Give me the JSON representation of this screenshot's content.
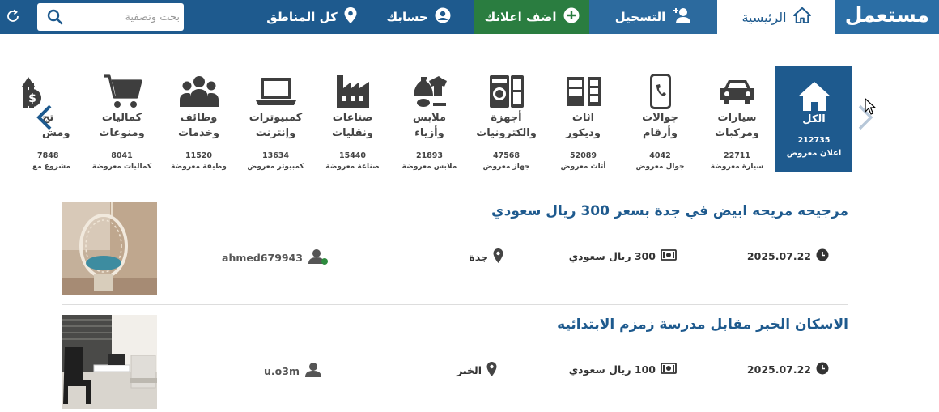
{
  "nav": {
    "brand": "مستعمل",
    "home": "الرئيسية",
    "register": "التسجيل",
    "add_ad": "اضف اعلانك",
    "account": "حسابك",
    "regions": "كل المناطق",
    "search_placeholder": "بحث وتصفية"
  },
  "categories": [
    {
      "name": "الكل",
      "count": "212735",
      "label": "اعلان معروض",
      "icon": "home-icon"
    },
    {
      "name": "سيارات\nومركبات",
      "count": "22711",
      "label": "سيارة معروضة",
      "icon": "car-icon"
    },
    {
      "name": "جوالات\nوأرقام",
      "count": "4042",
      "label": "جوال معروض",
      "icon": "phone-icon"
    },
    {
      "name": "اثاث\nوديكور",
      "count": "52089",
      "label": "أثاث معروض",
      "icon": "furniture-icon"
    },
    {
      "name": "أجهزة\nوالكترونيات",
      "count": "47568",
      "label": "جهاز معروض",
      "icon": "appliance-icon"
    },
    {
      "name": "ملابس\nوأزياء",
      "count": "21893",
      "label": "ملابس معروضة",
      "icon": "clothes-icon"
    },
    {
      "name": "صناعات\nونقليات",
      "count": "15440",
      "label": "صناعة معروضة",
      "icon": "factory-icon"
    },
    {
      "name": "كمبيوترات\nوإنترنت",
      "count": "13634",
      "label": "كمبيوتر معروض",
      "icon": "laptop-icon"
    },
    {
      "name": "وظائف\nوخدمات",
      "count": "11520",
      "label": "وظيفة معروضة",
      "icon": "people-icon"
    },
    {
      "name": "كماليات\nومنوعات",
      "count": "8041",
      "label": "كماليات معروضة",
      "icon": "cart-icon"
    },
    {
      "name": "تج\nومش",
      "count": "7848",
      "label": "مشروع مع",
      "icon": "money-icon"
    }
  ],
  "listings": [
    {
      "title": "مرجيحه مريحه ابيض في جدة بسعر 300 ريال سعودي",
      "date": "2025.07.22",
      "price": "300 ريال سعودي",
      "city": "جدة",
      "user": "ahmed679943",
      "online": true
    },
    {
      "title": "الاسكان الخبر مقابل مدرسة زمزم الابتدائيه",
      "date": "2025.07.22",
      "price": "100 ريال سعودي",
      "city": "الخبر",
      "user": "u.o3m",
      "online": false
    }
  ],
  "colors": {
    "primary": "#1e5a8e",
    "add_ad_green": "#2a7d40",
    "online_dot": "#2e8b3e"
  }
}
